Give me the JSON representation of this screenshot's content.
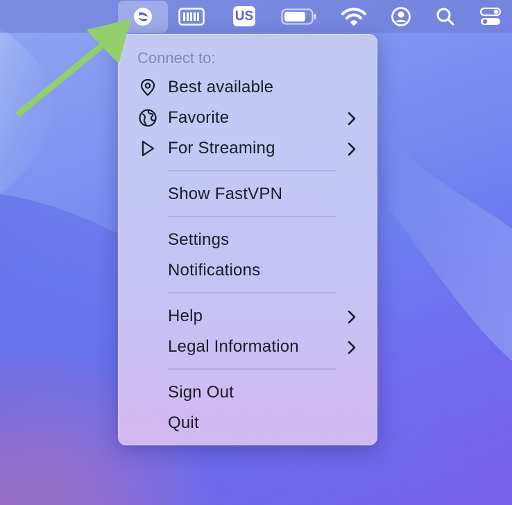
{
  "menubar": {
    "items": [
      {
        "icon": "fastvpn-logo-icon",
        "active": true
      },
      {
        "icon": "keyboard-icon"
      },
      {
        "icon": "input-source-icon",
        "label": "US"
      },
      {
        "icon": "battery-icon"
      },
      {
        "icon": "wifi-icon"
      },
      {
        "icon": "user-account-icon"
      },
      {
        "icon": "spotlight-search-icon"
      },
      {
        "icon": "control-center-icon"
      }
    ]
  },
  "menu": {
    "header": "Connect to:",
    "items": [
      {
        "label": "Best available",
        "icon": "location-pin-icon",
        "submenu": false
      },
      {
        "label": "Favorite",
        "icon": "favorite-globe-icon",
        "submenu": true
      },
      {
        "label": "For Streaming",
        "icon": "play-icon",
        "submenu": true
      },
      {
        "label": "Show FastVPN",
        "submenu": false
      },
      {
        "label": "Settings",
        "submenu": false
      },
      {
        "label": "Notifications",
        "submenu": false
      },
      {
        "label": "Help",
        "submenu": true
      },
      {
        "label": "Legal Information",
        "submenu": true
      },
      {
        "label": "Sign Out",
        "submenu": false
      },
      {
        "label": "Quit",
        "submenu": false
      }
    ]
  },
  "colors": {
    "arrow": "#92cf6a",
    "menu_text": "#1b1b2b",
    "menu_header": "#7f86b5",
    "us_badge_text": "#5b63c8"
  }
}
